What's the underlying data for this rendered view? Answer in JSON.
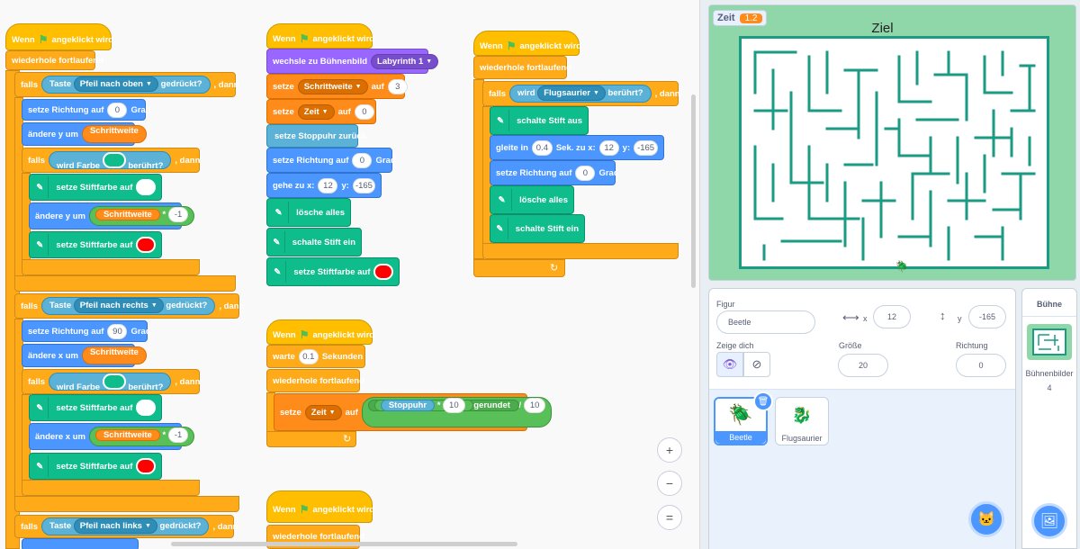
{
  "code": {
    "script1": {
      "hat": "Wenn",
      "hat_suffix": "angeklickt wird",
      "forever": "wiederhole fortlaufend",
      "if1": {
        "falls": "falls",
        "key_label": "Taste",
        "key": "Pfeil nach oben",
        "pressed": "gedrückt?",
        "dann": ", dann"
      },
      "turn_up": {
        "label": "setze Richtung auf",
        "value": "0",
        "unit": "Grad"
      },
      "change_y": {
        "label": "ändere y um",
        "var": "Schrittweite"
      },
      "if_color1": {
        "falls": "falls",
        "label": "wird Farbe",
        "touched": "berührt?",
        "dann": ", dann"
      },
      "pen_white": {
        "label": "setze Stiftfarbe auf"
      },
      "change_y_back": {
        "label": "ändere y um",
        "var": "Schrittweite",
        "op": "*",
        "factor": "-1"
      },
      "pen_red": {
        "label": "setze Stiftfarbe auf"
      },
      "if2": {
        "falls": "falls",
        "key_label": "Taste",
        "key": "Pfeil nach rechts",
        "pressed": "gedrückt?",
        "dann": ", dann"
      },
      "turn_right": {
        "label": "setze Richtung auf",
        "value": "90",
        "unit": "Grad"
      },
      "change_x": {
        "label": "ändere x um",
        "var": "Schrittweite"
      },
      "if_color2": {
        "falls": "falls",
        "label": "wird Farbe",
        "touched": "berührt?",
        "dann": ", dann"
      },
      "pen_white2": {
        "label": "setze Stiftfarbe auf"
      },
      "change_x_back": {
        "label": "ändere x um",
        "var": "Schrittweite",
        "op": "*",
        "factor": "-1"
      },
      "pen_red2": {
        "label": "setze Stiftfarbe auf"
      },
      "if3": {
        "falls": "falls",
        "key_label": "Taste",
        "key": "Pfeil nach links",
        "pressed": "gedrückt?",
        "dann": ", dann"
      }
    },
    "script2": {
      "hat": "Wenn",
      "hat_suffix": "angeklickt wird",
      "backdrop": {
        "label": "wechsle zu Bühnenbild",
        "value": "Labyrinth 1"
      },
      "set_step": {
        "label": "setze",
        "var": "Schrittweite",
        "to": "auf",
        "value": "3"
      },
      "set_time": {
        "label": "setze",
        "var": "Zeit",
        "to": "auf",
        "value": "0"
      },
      "reset_timer": "setze Stoppuhr zurück",
      "turn": {
        "label": "setze Richtung auf",
        "value": "0",
        "unit": "Grad"
      },
      "goto": {
        "label": "gehe zu x:",
        "x": "12",
        "ylabel": "y:",
        "y": "-165"
      },
      "clear": "lösche alles",
      "pen_down": "schalte Stift ein",
      "pen_red": "setze Stiftfarbe auf"
    },
    "script3": {
      "hat": "Wenn",
      "hat_suffix": "angeklickt wird",
      "forever": "wiederhole fortlaufend",
      "if": {
        "falls": "falls",
        "label": "wird",
        "sprite": "Flugsaurier",
        "touched": "berührt?",
        "dann": ", dann"
      },
      "pen_up": "schalte Stift aus",
      "glide": {
        "label": "gleite in",
        "secs": "0.4",
        "mid": "Sek. zu x:",
        "x": "12",
        "ylabel": "y:",
        "y": "-165"
      },
      "turn": {
        "label": "setze Richtung auf",
        "value": "0",
        "unit": "Grad"
      },
      "clear": "lösche alles",
      "pen_down": "schalte Stift ein"
    },
    "script4": {
      "hat": "Wenn",
      "hat_suffix": "angeklickt wird",
      "wait": {
        "label": "warte",
        "value": "0.1",
        "unit": "Sekunden"
      },
      "forever": "wiederhole fortlaufend",
      "set": {
        "label": "setze",
        "var": "Zeit",
        "to": "auf",
        "reporter": "Stoppuhr",
        "op": "*",
        "factor": "10",
        "round": "gerundet",
        "div": "/",
        "divisor": "10"
      }
    },
    "script5": {
      "hat": "Wenn",
      "hat_suffix": "angeklickt wird",
      "forever": "wiederhole fortlaufend"
    },
    "zoom": {
      "in": "+",
      "out": "−",
      "reset": "="
    }
  },
  "stage": {
    "timer_label": "Zeit",
    "timer_value": "1.2",
    "goal_text": "Ziel"
  },
  "sprite_info": {
    "figur_label": "Figur",
    "name": "Beetle",
    "x_label": "x",
    "x": "12",
    "y_label": "y",
    "y": "-165",
    "show_label": "Zeige dich",
    "size_label": "Größe",
    "size": "20",
    "direction_label": "Richtung",
    "direction": "0"
  },
  "sprites": [
    {
      "name": "Beetle",
      "selected": true
    },
    {
      "name": "Flugsaurier",
      "selected": false
    }
  ],
  "stage_panel": {
    "title": "Bühne",
    "backdrops_label": "Bühnenbilder",
    "backdrops_count": "4"
  },
  "colors": {
    "events": "#ffbf00",
    "control": "#ffab19",
    "motion": "#4c97ff",
    "pen": "#0fbd8c",
    "looks": "#9966ff",
    "variables": "#ff8c1a",
    "sensing": "#5cb1d6",
    "operators": "#59c059",
    "maze_wall": "#1b9b83",
    "stage_bg": "#8fd6a9",
    "touch_color": "#0fbd8c",
    "pen_white": "#ffffff",
    "pen_red": "#ff0000"
  }
}
